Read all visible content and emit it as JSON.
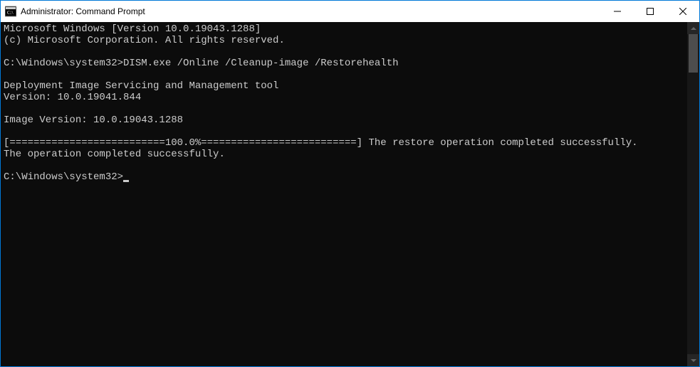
{
  "titlebar": {
    "title": "Administrator: Command Prompt"
  },
  "terminal": {
    "line1": "Microsoft Windows [Version 10.0.19043.1288]",
    "line2": "(c) Microsoft Corporation. All rights reserved.",
    "blank1": "",
    "prompt1": "C:\\Windows\\system32>DISM.exe /Online /Cleanup-image /Restorehealth",
    "blank2": "",
    "line3": "Deployment Image Servicing and Management tool",
    "line4": "Version: 10.0.19041.844",
    "blank3": "",
    "line5": "Image Version: 10.0.19043.1288",
    "blank4": "",
    "line6": "[==========================100.0%==========================] The restore operation completed successfully.",
    "line7": "The operation completed successfully.",
    "blank5": "",
    "prompt2": "C:\\Windows\\system32>"
  }
}
